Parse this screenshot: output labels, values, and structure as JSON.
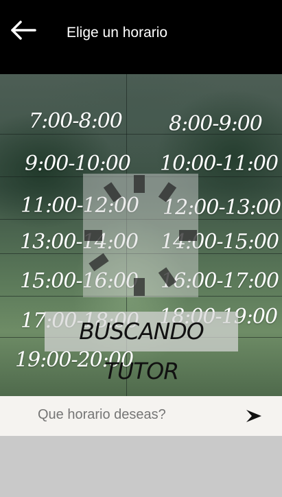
{
  "header": {
    "title": "Elige un horario"
  },
  "slots": {
    "left": [
      "7:00-8:00",
      "9:00-10:00",
      "11:00-12:00",
      "13:00-14:00",
      "15:00-16:00",
      "17:00-18:00",
      "19:00-20:00"
    ],
    "right": [
      "8:00-9:00",
      "10:00-11:00",
      "12:00-13:00",
      "14:00-15:00",
      "16:00-17:00",
      "18:00-19:00"
    ]
  },
  "loading": {
    "label": "BUSCANDO TUTOR"
  },
  "input": {
    "placeholder": "Que horario deseas?"
  },
  "icons": {
    "back": "arrow-left-icon",
    "send": "send-arrow-icon",
    "loading": "spinner-icon"
  },
  "colors": {
    "header_bg": "#000000",
    "input_bg": "#f5f3f0",
    "footer_bg": "#c9c9c9"
  }
}
